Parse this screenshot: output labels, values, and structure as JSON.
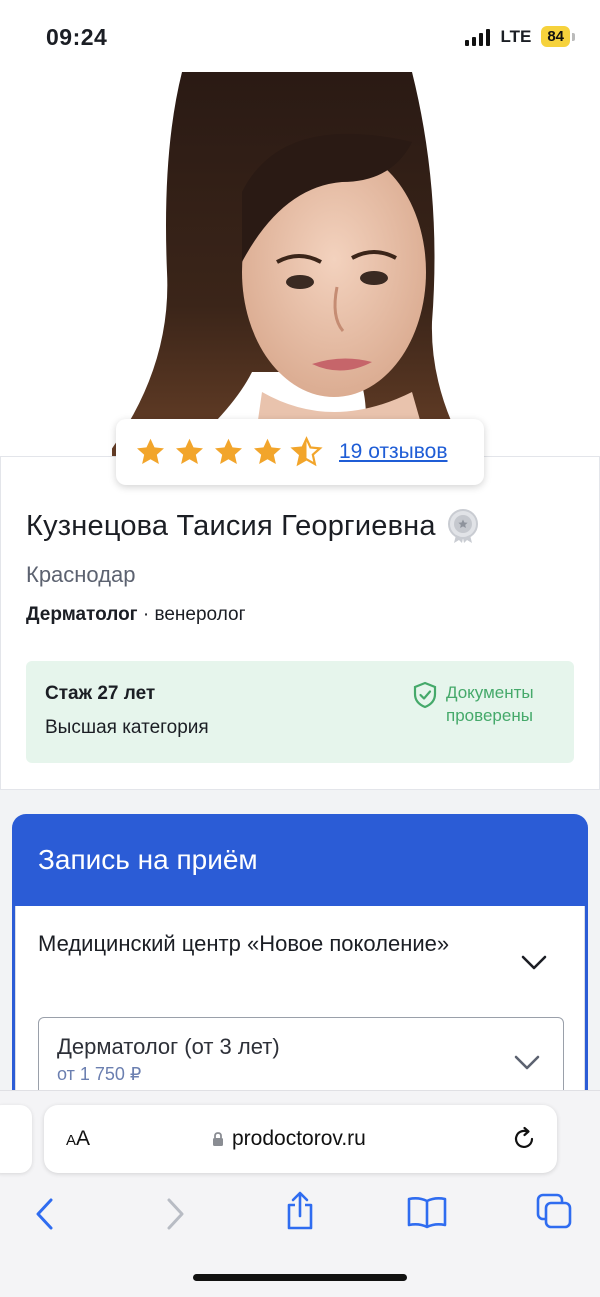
{
  "status_bar": {
    "time": "09:24",
    "network": "LTE",
    "battery": "84"
  },
  "doctor": {
    "rating_stars": 4.5,
    "reviews_link": "19 отзывов",
    "name": "Кузнецова Таисия Георгиевна",
    "city": "Краснодар",
    "specialty_main": "Дерматолог",
    "specialty_rest": " · венеролог",
    "experience": "Стаж 27 лет",
    "category": "Высшая категория",
    "documents_line1": "Документы",
    "documents_line2": "проверены"
  },
  "booking": {
    "title": "Запись на приём",
    "clinic": "Медицинский центр «Новое поколение»",
    "service": "Дерматолог (от 3 лет)",
    "price": "от 1 750 ₽"
  },
  "browser": {
    "aa_label_small": "A",
    "aa_label_big": "A",
    "url": "prodoctorov.ru"
  },
  "colors": {
    "brand_blue": "#2b5cd6",
    "star": "#f2a52b",
    "verified_green": "#45a96a",
    "info_bg": "#e6f5ec"
  },
  "icons": [
    "signal-icon",
    "battery-icon",
    "star-icon",
    "award-badge-icon",
    "shield-check-icon",
    "chevron-down-icon",
    "lock-icon",
    "reload-icon",
    "back-icon",
    "forward-icon",
    "share-icon",
    "bookmarks-icon",
    "tabs-icon"
  ]
}
